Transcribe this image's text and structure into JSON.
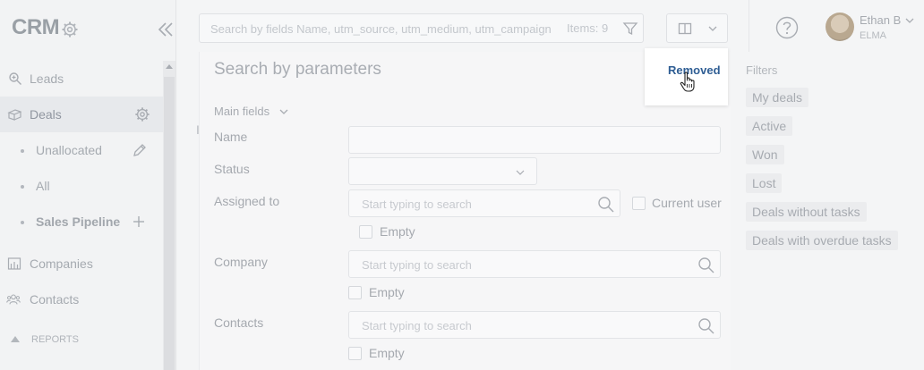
{
  "sidebar": {
    "title": "CRM",
    "items": [
      {
        "label": "Leads"
      },
      {
        "label": "Deals"
      },
      {
        "label": "Unallocated"
      },
      {
        "label": "All"
      },
      {
        "label": "Sales Pipeline"
      },
      {
        "label": "Companies"
      },
      {
        "label": "Contacts"
      }
    ],
    "reports_label": "REPORTS"
  },
  "topbar": {
    "search_placeholder": "Search by fields Name, utm_source, utm_medium, utm_campaign",
    "items_count": "Items: 9",
    "user": {
      "name": "Ethan B",
      "org": "ELMA"
    }
  },
  "main": {
    "background_letter": "I"
  },
  "search_panel": {
    "title": "Search by parameters",
    "removed_button": "Removed",
    "section_label": "Main fields",
    "fields": {
      "name_label": "Name",
      "status_label": "Status",
      "assigned_label": "Assigned to",
      "assigned_placeholder": "Start typing to search",
      "current_user_label": "Current user",
      "empty_label": "Empty",
      "company_label": "Company",
      "company_placeholder": "Start typing to search",
      "contacts_label": "Contacts",
      "contacts_placeholder": "Start typing to search"
    }
  },
  "filters": {
    "title": "Filters",
    "items": [
      "My deals",
      "Active",
      "Won",
      "Lost",
      "Deals without tasks",
      "Deals with overdue tasks"
    ]
  },
  "colors": {
    "accent": "#2f5e94",
    "muted_text": "#a5a9af"
  }
}
